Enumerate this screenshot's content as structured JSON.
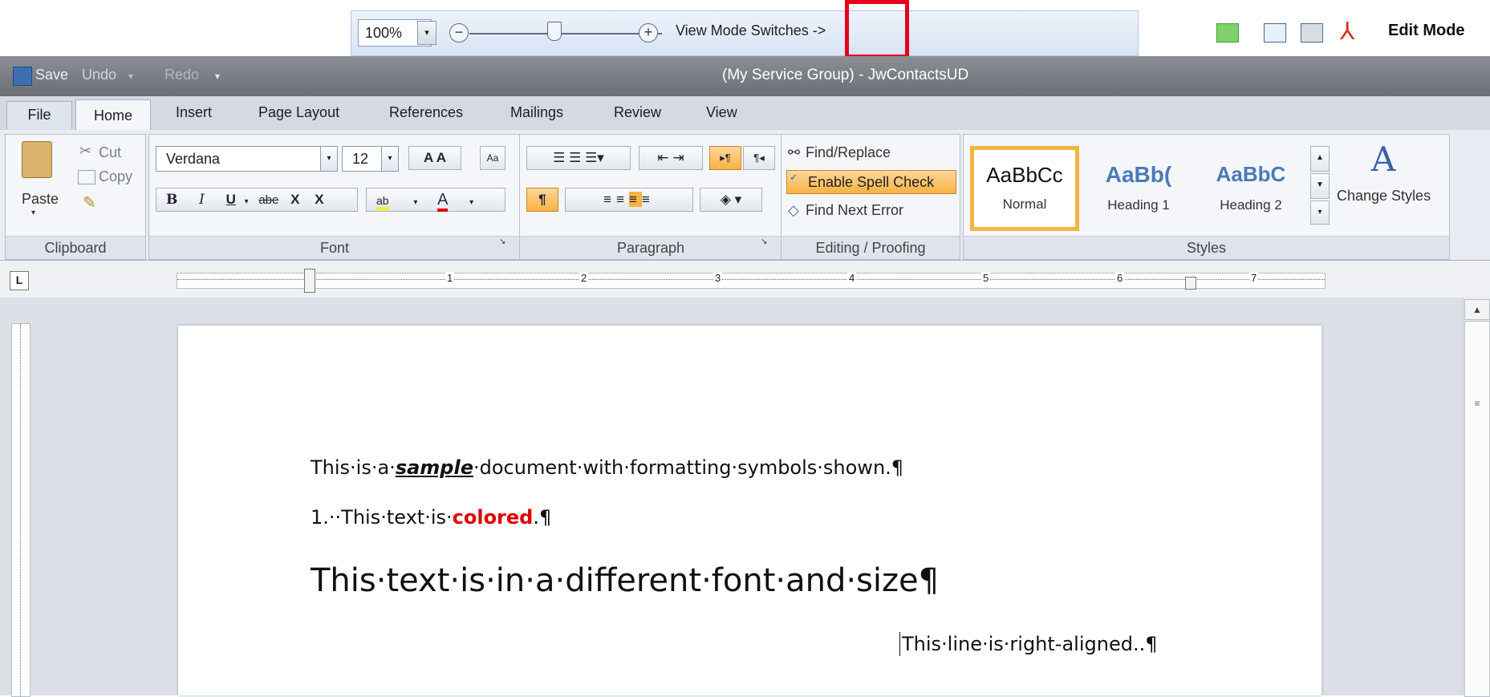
{
  "viewbar": {
    "zoom": "100%",
    "minus": "−",
    "plus": "+",
    "label": "View Mode Switches ->",
    "edit_mode": "Edit Mode"
  },
  "titlebar": {
    "save": "Save",
    "undo": "Undo",
    "redo": "Redo",
    "title": "(My Service Group)  - JwContactsUD"
  },
  "tabs": [
    "File",
    "Home",
    "Insert",
    "Page Layout",
    "References",
    "Mailings",
    "Review",
    "View"
  ],
  "ribbon": {
    "clipboard": {
      "label": "Clipboard",
      "paste": "Paste",
      "cut": "Cut",
      "copy": "Copy"
    },
    "font": {
      "label": "Font",
      "font_name": "Verdana",
      "font_size": "12",
      "bold": "B",
      "italic": "I",
      "underline": "U",
      "strike": "abe",
      "subscript": "X",
      "superscript": "X",
      "highlight": "ab",
      "color": "A"
    },
    "paragraph": {
      "label": "Paragraph",
      "pilcrow": "¶"
    },
    "editing": {
      "label": "Editing / Proofing",
      "find_replace": "Find/Replace",
      "spell_check": "Enable Spell Check",
      "find_next_error": "Find Next Error"
    },
    "styles": {
      "label": "Styles",
      "items": [
        {
          "sample": "AaBbCc",
          "name": "Normal"
        },
        {
          "sample": "AaBb(",
          "name": "Heading 1"
        },
        {
          "sample": "AaBbC",
          "name": "Heading 2"
        }
      ],
      "change_styles": "Change Styles"
    }
  },
  "ruler": {
    "numbers": [
      "1",
      "2",
      "3",
      "4",
      "5",
      "6",
      "7"
    ]
  },
  "document": {
    "line1_prefix": "This·is·a·",
    "line1_emph": "sample",
    "line1_suffix": "·document·with·formatting·symbols·shown.¶",
    "line2_prefix": "1.··This·text·is·",
    "line2_colored": "colored",
    "line2_suffix": ".¶",
    "line3": "This·text·is·in·a·different·font·and·size¶",
    "line4": "This·line·is·right-aligned..¶"
  },
  "colors": {
    "accent": "#e8001c",
    "highlight_on": "#f9b244",
    "colored_text": "#e00000",
    "heading_blue": "#4a7ab8"
  }
}
